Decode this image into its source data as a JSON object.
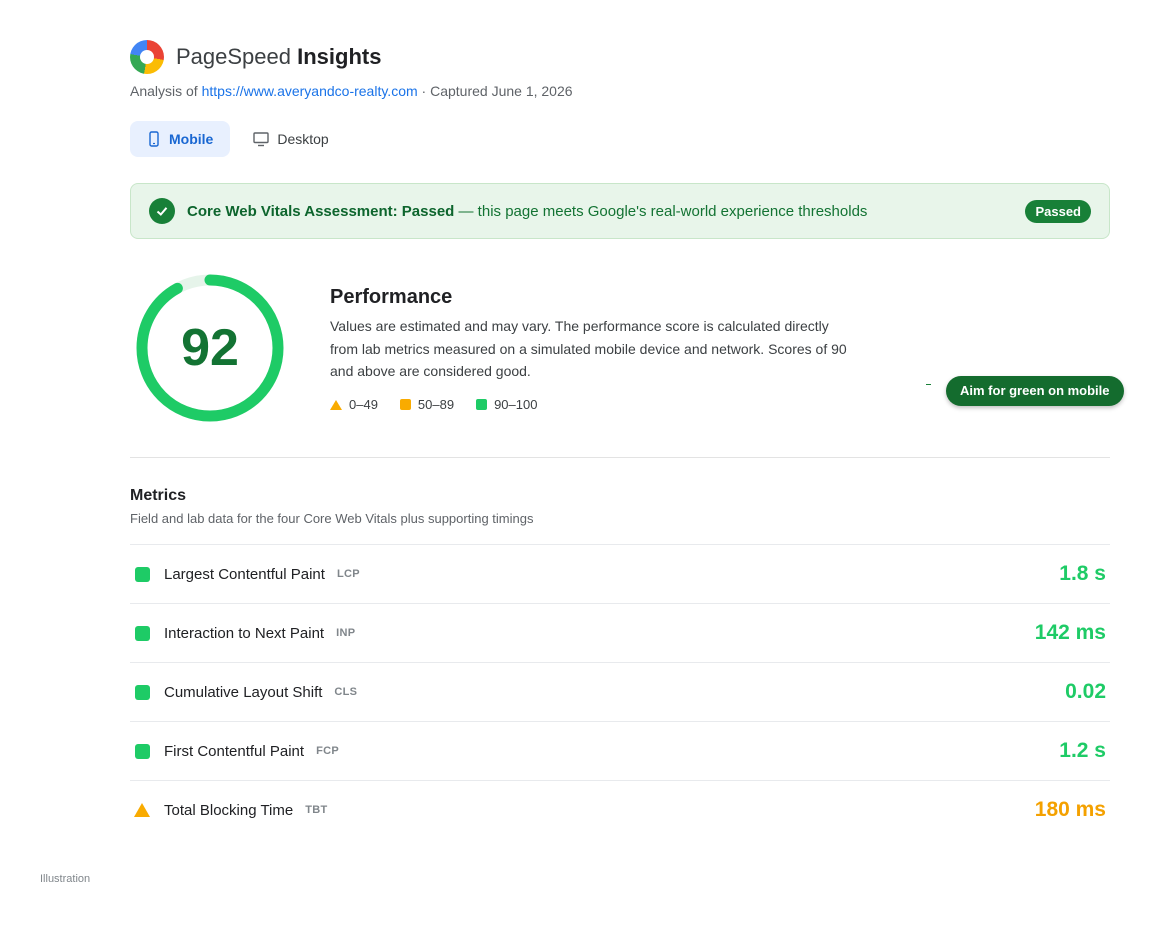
{
  "header": {
    "title_light": "PageSpeed",
    "title_bold": "Insights",
    "analysis_prefix": "Analysis of",
    "url": "https://www.averyandco-realty.com",
    "captured": "· Captured June 1, 2026"
  },
  "tabs": [
    {
      "label": "Mobile",
      "icon": "phone-icon",
      "active": true
    },
    {
      "label": "Desktop",
      "icon": "monitor-icon",
      "active": false
    }
  ],
  "cwv": {
    "title": "Core Web Vitals Assessment: Passed",
    "text": "— this page meets Google's real-world experience thresholds",
    "badge": "Passed"
  },
  "performance": {
    "score": 92,
    "title": "Performance",
    "description": "Values are estimated and may vary. The performance score is calculated directly from lab metrics measured on a simulated mobile device and network. Scores of 90 and above are considered good.",
    "legend": [
      {
        "label": "0–49",
        "shape": "triangle",
        "color": "#f9ab00"
      },
      {
        "label": "50–89",
        "shape": "square",
        "color": "#f9ab00"
      },
      {
        "label": "90–100",
        "shape": "square",
        "color": "#1ecb66"
      }
    ],
    "callout": "Aim for green on mobile"
  },
  "metrics": {
    "title": "Metrics",
    "subtitle": "Field and lab data for the four Core Web Vitals plus supporting timings",
    "items": [
      {
        "name": "Largest Contentful Paint",
        "abbr": "LCP",
        "value": "1.8 s",
        "status": "good",
        "color": "#1ecb66"
      },
      {
        "name": "Interaction to Next Paint",
        "abbr": "INP",
        "value": "142 ms",
        "status": "good",
        "color": "#1ecb66"
      },
      {
        "name": "Cumulative Layout Shift",
        "abbr": "CLS",
        "value": "0.02",
        "status": "good",
        "color": "#1ecb66"
      },
      {
        "name": "First Contentful Paint",
        "abbr": "FCP",
        "value": "1.2 s",
        "status": "good",
        "color": "#1ecb66"
      },
      {
        "name": "Total Blocking Time",
        "abbr": "TBT",
        "value": "180 ms",
        "status": "poor",
        "color": "#f4a100"
      }
    ]
  },
  "footer": {
    "note": "Illustration"
  },
  "colors": {
    "good": "#1ecb66",
    "warn": "#f9ab00",
    "accent": "#1a73e8",
    "pass": "#188038"
  }
}
